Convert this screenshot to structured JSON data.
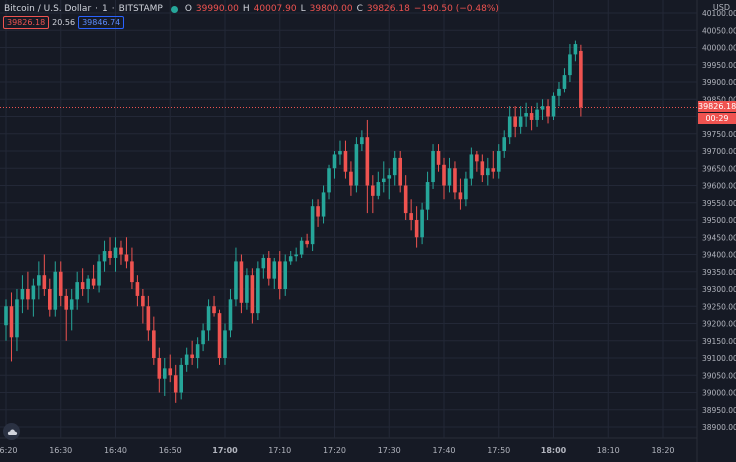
{
  "legend": {
    "symbol": "Bitcoin / U.S. Dollar",
    "interval": "1",
    "exchange": "BITSTAMP",
    "o_label": "O",
    "o": "39990.00",
    "h_label": "H",
    "h": "40007.90",
    "l_label": "L",
    "l": "39800.00",
    "c_label": "C",
    "c": "39826.18",
    "change": "−190.50 (−0.48%)"
  },
  "spread": {
    "bid": "39826.18",
    "spread": "20.56",
    "ask": "39846.74"
  },
  "currency": "USD",
  "last_price": "39826.18",
  "countdown": "00:29",
  "colors": {
    "up": "#26a69a",
    "down": "#ef5350",
    "background": "#161a25",
    "grid": "#232837",
    "axis_text": "#b2b5be"
  },
  "icons": {
    "logo": "tradingview-cloud-icon"
  },
  "chart_data": {
    "type": "candlestick",
    "title": "",
    "ylim": [
      38875,
      40120
    ],
    "y_ticks": [
      "40100.00",
      "40050.00",
      "40000.00",
      "39950.00",
      "39900.00",
      "39850.00",
      "39800.00",
      "39750.00",
      "39700.00",
      "39650.00",
      "39600.00",
      "39550.00",
      "39500.00",
      "39450.00",
      "39400.00",
      "39350.00",
      "39300.00",
      "39250.00",
      "39200.00",
      "39150.00",
      "39100.00",
      "39050.00",
      "39000.00",
      "38950.00",
      "38900.00"
    ],
    "x_ticks": [
      "16:20",
      "16:30",
      "16:40",
      "16:50",
      "17:00",
      "17:10",
      "17:20",
      "17:30",
      "17:40",
      "17:50",
      "18:00",
      "18:10",
      "18:20"
    ],
    "x_start": "16:20",
    "grid": true,
    "last_price_line": 39826.18,
    "candles": [
      {
        "t": "16:20",
        "o": 39195,
        "h": 39270,
        "l": 39150,
        "c": 39250
      },
      {
        "t": "16:21",
        "o": 39250,
        "h": 39290,
        "l": 39090,
        "c": 39160
      },
      {
        "t": "16:22",
        "o": 39160,
        "h": 39300,
        "l": 39120,
        "c": 39270
      },
      {
        "t": "16:23",
        "o": 39270,
        "h": 39340,
        "l": 39230,
        "c": 39300
      },
      {
        "t": "16:24",
        "o": 39300,
        "h": 39350,
        "l": 39240,
        "c": 39270
      },
      {
        "t": "16:25",
        "o": 39270,
        "h": 39330,
        "l": 39220,
        "c": 39310
      },
      {
        "t": "16:26",
        "o": 39310,
        "h": 39380,
        "l": 39270,
        "c": 39340
      },
      {
        "t": "16:27",
        "o": 39340,
        "h": 39400,
        "l": 39280,
        "c": 39300
      },
      {
        "t": "16:28",
        "o": 39300,
        "h": 39330,
        "l": 39220,
        "c": 39240
      },
      {
        "t": "16:29",
        "o": 39240,
        "h": 39380,
        "l": 39220,
        "c": 39350
      },
      {
        "t": "16:30",
        "o": 39350,
        "h": 39380,
        "l": 39250,
        "c": 39280
      },
      {
        "t": "16:31",
        "o": 39280,
        "h": 39300,
        "l": 39150,
        "c": 39240
      },
      {
        "t": "16:32",
        "o": 39240,
        "h": 39300,
        "l": 39180,
        "c": 39270
      },
      {
        "t": "16:33",
        "o": 39270,
        "h": 39350,
        "l": 39240,
        "c": 39320
      },
      {
        "t": "16:34",
        "o": 39320,
        "h": 39360,
        "l": 39280,
        "c": 39300
      },
      {
        "t": "16:35",
        "o": 39300,
        "h": 39340,
        "l": 39260,
        "c": 39330
      },
      {
        "t": "16:36",
        "o": 39330,
        "h": 39370,
        "l": 39300,
        "c": 39310
      },
      {
        "t": "16:37",
        "o": 39310,
        "h": 39400,
        "l": 39290,
        "c": 39380
      },
      {
        "t": "16:38",
        "o": 39380,
        "h": 39440,
        "l": 39350,
        "c": 39410
      },
      {
        "t": "16:39",
        "o": 39410,
        "h": 39450,
        "l": 39370,
        "c": 39390
      },
      {
        "t": "16:40",
        "o": 39390,
        "h": 39450,
        "l": 39350,
        "c": 39420
      },
      {
        "t": "16:41",
        "o": 39420,
        "h": 39440,
        "l": 39370,
        "c": 39400
      },
      {
        "t": "16:42",
        "o": 39400,
        "h": 39450,
        "l": 39360,
        "c": 39380
      },
      {
        "t": "16:43",
        "o": 39380,
        "h": 39420,
        "l": 39300,
        "c": 39320
      },
      {
        "t": "16:44",
        "o": 39320,
        "h": 39340,
        "l": 39250,
        "c": 39280
      },
      {
        "t": "16:45",
        "o": 39280,
        "h": 39300,
        "l": 39200,
        "c": 39250
      },
      {
        "t": "16:46",
        "o": 39250,
        "h": 39280,
        "l": 39150,
        "c": 39180
      },
      {
        "t": "16:47",
        "o": 39180,
        "h": 39220,
        "l": 39080,
        "c": 39100
      },
      {
        "t": "16:48",
        "o": 39100,
        "h": 39130,
        "l": 39000,
        "c": 39040
      },
      {
        "t": "16:49",
        "o": 39040,
        "h": 39100,
        "l": 38990,
        "c": 39070
      },
      {
        "t": "16:50",
        "o": 39070,
        "h": 39110,
        "l": 39030,
        "c": 39050
      },
      {
        "t": "16:51",
        "o": 39050,
        "h": 39080,
        "l": 38970,
        "c": 39000
      },
      {
        "t": "16:52",
        "o": 39000,
        "h": 39100,
        "l": 38980,
        "c": 39080
      },
      {
        "t": "16:53",
        "o": 39080,
        "h": 39130,
        "l": 39060,
        "c": 39110
      },
      {
        "t": "16:54",
        "o": 39110,
        "h": 39150,
        "l": 39080,
        "c": 39100
      },
      {
        "t": "16:55",
        "o": 39100,
        "h": 39160,
        "l": 39070,
        "c": 39140
      },
      {
        "t": "16:56",
        "o": 39140,
        "h": 39200,
        "l": 39120,
        "c": 39180
      },
      {
        "t": "16:57",
        "o": 39180,
        "h": 39270,
        "l": 39150,
        "c": 39250
      },
      {
        "t": "16:58",
        "o": 39250,
        "h": 39280,
        "l": 39220,
        "c": 39230
      },
      {
        "t": "16:59",
        "o": 39230,
        "h": 39240,
        "l": 39080,
        "c": 39100
      },
      {
        "t": "17:00",
        "o": 39100,
        "h": 39200,
        "l": 39080,
        "c": 39180
      },
      {
        "t": "17:01",
        "o": 39180,
        "h": 39300,
        "l": 39160,
        "c": 39270
      },
      {
        "t": "17:02",
        "o": 39270,
        "h": 39420,
        "l": 39250,
        "c": 39380
      },
      {
        "t": "17:03",
        "o": 39380,
        "h": 39400,
        "l": 39230,
        "c": 39260
      },
      {
        "t": "17:04",
        "o": 39260,
        "h": 39360,
        "l": 39240,
        "c": 39340
      },
      {
        "t": "17:05",
        "o": 39340,
        "h": 39360,
        "l": 39200,
        "c": 39230
      },
      {
        "t": "17:06",
        "o": 39230,
        "h": 39380,
        "l": 39210,
        "c": 39360
      },
      {
        "t": "17:07",
        "o": 39360,
        "h": 39400,
        "l": 39330,
        "c": 39390
      },
      {
        "t": "17:08",
        "o": 39390,
        "h": 39410,
        "l": 39310,
        "c": 39330
      },
      {
        "t": "17:09",
        "o": 39330,
        "h": 39390,
        "l": 39300,
        "c": 39380
      },
      {
        "t": "17:10",
        "o": 39380,
        "h": 39410,
        "l": 39270,
        "c": 39300
      },
      {
        "t": "17:11",
        "o": 39300,
        "h": 39400,
        "l": 39280,
        "c": 39380
      },
      {
        "t": "17:12",
        "o": 39380,
        "h": 39410,
        "l": 39370,
        "c": 39395
      },
      {
        "t": "17:13",
        "o": 39395,
        "h": 39420,
        "l": 39380,
        "c": 39400
      },
      {
        "t": "17:14",
        "o": 39400,
        "h": 39450,
        "l": 39390,
        "c": 39440
      },
      {
        "t": "17:15",
        "o": 39440,
        "h": 39460,
        "l": 39420,
        "c": 39430
      },
      {
        "t": "17:16",
        "o": 39430,
        "h": 39560,
        "l": 39410,
        "c": 39540
      },
      {
        "t": "17:17",
        "o": 39540,
        "h": 39560,
        "l": 39480,
        "c": 39510
      },
      {
        "t": "17:18",
        "o": 39510,
        "h": 39600,
        "l": 39490,
        "c": 39580
      },
      {
        "t": "17:19",
        "o": 39580,
        "h": 39660,
        "l": 39560,
        "c": 39650
      },
      {
        "t": "17:20",
        "o": 39650,
        "h": 39700,
        "l": 39620,
        "c": 39690
      },
      {
        "t": "17:21",
        "o": 39690,
        "h": 39730,
        "l": 39660,
        "c": 39700
      },
      {
        "t": "17:22",
        "o": 39700,
        "h": 39730,
        "l": 39620,
        "c": 39640
      },
      {
        "t": "17:23",
        "o": 39640,
        "h": 39670,
        "l": 39570,
        "c": 39600
      },
      {
        "t": "17:24",
        "o": 39600,
        "h": 39740,
        "l": 39580,
        "c": 39720
      },
      {
        "t": "17:25",
        "o": 39720,
        "h": 39760,
        "l": 39700,
        "c": 39740
      },
      {
        "t": "17:26",
        "o": 39740,
        "h": 39790,
        "l": 39520,
        "c": 39600
      },
      {
        "t": "17:27",
        "o": 39600,
        "h": 39630,
        "l": 39520,
        "c": 39570
      },
      {
        "t": "17:28",
        "o": 39570,
        "h": 39640,
        "l": 39560,
        "c": 39610
      },
      {
        "t": "17:29",
        "o": 39610,
        "h": 39670,
        "l": 39580,
        "c": 39620
      },
      {
        "t": "17:30",
        "o": 39620,
        "h": 39650,
        "l": 39560,
        "c": 39630
      },
      {
        "t": "17:31",
        "o": 39630,
        "h": 39700,
        "l": 39600,
        "c": 39680
      },
      {
        "t": "17:32",
        "o": 39680,
        "h": 39700,
        "l": 39580,
        "c": 39600
      },
      {
        "t": "17:33",
        "o": 39600,
        "h": 39630,
        "l": 39500,
        "c": 39520
      },
      {
        "t": "17:34",
        "o": 39520,
        "h": 39560,
        "l": 39470,
        "c": 39500
      },
      {
        "t": "17:35",
        "o": 39500,
        "h": 39540,
        "l": 39420,
        "c": 39450
      },
      {
        "t": "17:36",
        "o": 39450,
        "h": 39550,
        "l": 39430,
        "c": 39530
      },
      {
        "t": "17:37",
        "o": 39530,
        "h": 39640,
        "l": 39500,
        "c": 39610
      },
      {
        "t": "17:38",
        "o": 39610,
        "h": 39720,
        "l": 39590,
        "c": 39700
      },
      {
        "t": "17:39",
        "o": 39700,
        "h": 39720,
        "l": 39640,
        "c": 39660
      },
      {
        "t": "17:40",
        "o": 39660,
        "h": 39680,
        "l": 39560,
        "c": 39600
      },
      {
        "t": "17:41",
        "o": 39600,
        "h": 39680,
        "l": 39580,
        "c": 39650
      },
      {
        "t": "17:42",
        "o": 39650,
        "h": 39670,
        "l": 39560,
        "c": 39580
      },
      {
        "t": "17:43",
        "o": 39580,
        "h": 39620,
        "l": 39530,
        "c": 39560
      },
      {
        "t": "17:44",
        "o": 39560,
        "h": 39640,
        "l": 39540,
        "c": 39620
      },
      {
        "t": "17:45",
        "o": 39620,
        "h": 39710,
        "l": 39600,
        "c": 39690
      },
      {
        "t": "17:46",
        "o": 39690,
        "h": 39700,
        "l": 39640,
        "c": 39670
      },
      {
        "t": "17:47",
        "o": 39670,
        "h": 39690,
        "l": 39610,
        "c": 39630
      },
      {
        "t": "17:48",
        "o": 39630,
        "h": 39680,
        "l": 39600,
        "c": 39650
      },
      {
        "t": "17:49",
        "o": 39650,
        "h": 39700,
        "l": 39620,
        "c": 39640
      },
      {
        "t": "17:50",
        "o": 39640,
        "h": 39720,
        "l": 39620,
        "c": 39700
      },
      {
        "t": "17:51",
        "o": 39700,
        "h": 39760,
        "l": 39680,
        "c": 39740
      },
      {
        "t": "17:52",
        "o": 39740,
        "h": 39830,
        "l": 39720,
        "c": 39800
      },
      {
        "t": "17:53",
        "o": 39800,
        "h": 39830,
        "l": 39740,
        "c": 39770
      },
      {
        "t": "17:54",
        "o": 39770,
        "h": 39830,
        "l": 39750,
        "c": 39800
      },
      {
        "t": "17:55",
        "o": 39800,
        "h": 39840,
        "l": 39770,
        "c": 39810
      },
      {
        "t": "17:56",
        "o": 39810,
        "h": 39830,
        "l": 39760,
        "c": 39790
      },
      {
        "t": "17:57",
        "o": 39790,
        "h": 39840,
        "l": 39770,
        "c": 39820
      },
      {
        "t": "17:58",
        "o": 39820,
        "h": 39850,
        "l": 39790,
        "c": 39830
      },
      {
        "t": "17:59",
        "o": 39830,
        "h": 39850,
        "l": 39780,
        "c": 39800
      },
      {
        "t": "18:00",
        "o": 39800,
        "h": 39870,
        "l": 39790,
        "c": 39860
      },
      {
        "t": "18:01",
        "o": 39860,
        "h": 39900,
        "l": 39830,
        "c": 39880
      },
      {
        "t": "18:02",
        "o": 39880,
        "h": 39940,
        "l": 39870,
        "c": 39920
      },
      {
        "t": "18:03",
        "o": 39920,
        "h": 40010,
        "l": 39900,
        "c": 39980
      },
      {
        "t": "18:04",
        "o": 39980,
        "h": 40020,
        "l": 39960,
        "c": 40010
      },
      {
        "t": "18:05",
        "o": 39990,
        "h": 40007.9,
        "l": 39800,
        "c": 39826.18
      }
    ]
  }
}
